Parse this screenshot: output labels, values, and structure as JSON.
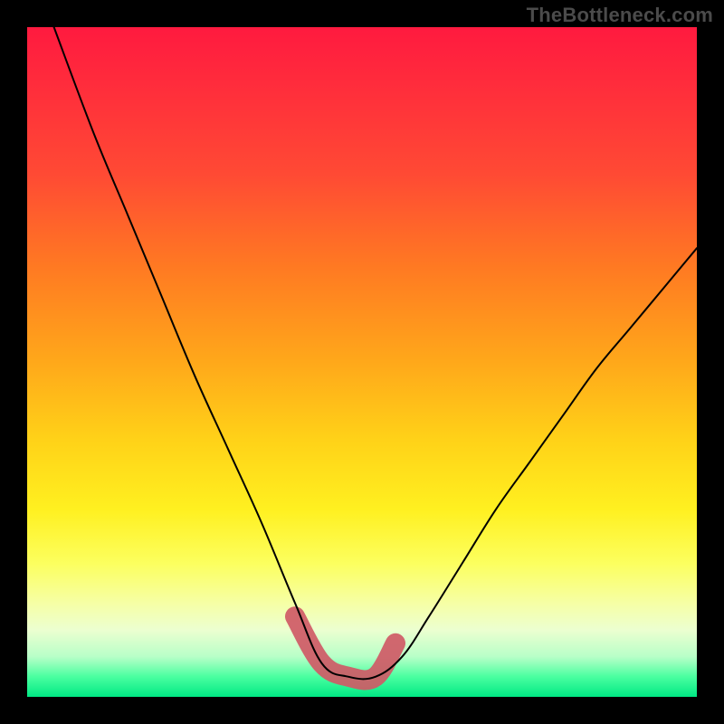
{
  "watermark": {
    "text": "TheBottleneck.com"
  },
  "colors": {
    "frame_bg": "#000000",
    "gradient_top": "#ff1a3f",
    "gradient_mid": "#ffd318",
    "gradient_bottom": "#00e884",
    "curve_stroke": "#000000",
    "valley_highlight": "#cf5a66"
  },
  "chart_data": {
    "type": "line",
    "title": "",
    "xlabel": "",
    "ylabel": "",
    "xlim": [
      0,
      100
    ],
    "ylim": [
      0,
      100
    ],
    "grid": false,
    "legend": false,
    "annotations": [],
    "description": "V-shaped bottleneck curve with a flat minimum around x≈44–52. Background is a rainbow heat gradient (red at top through yellow to green at bottom). A thick muted-red segment highlights the valley floor.",
    "series": [
      {
        "name": "bottleneck-curve",
        "x": [
          4,
          10,
          15,
          20,
          25,
          30,
          35,
          40,
          44,
          48,
          52,
          56,
          60,
          65,
          70,
          75,
          80,
          85,
          90,
          95,
          100
        ],
        "y": [
          100,
          84,
          72,
          60,
          48,
          37,
          26,
          14,
          5,
          3,
          3,
          6,
          12,
          20,
          28,
          35,
          42,
          49,
          55,
          61,
          67
        ]
      }
    ],
    "highlight": {
      "name": "valley-floor",
      "x": [
        40,
        44,
        48,
        52,
        55
      ],
      "y": [
        12,
        5,
        3,
        3,
        8
      ]
    }
  }
}
